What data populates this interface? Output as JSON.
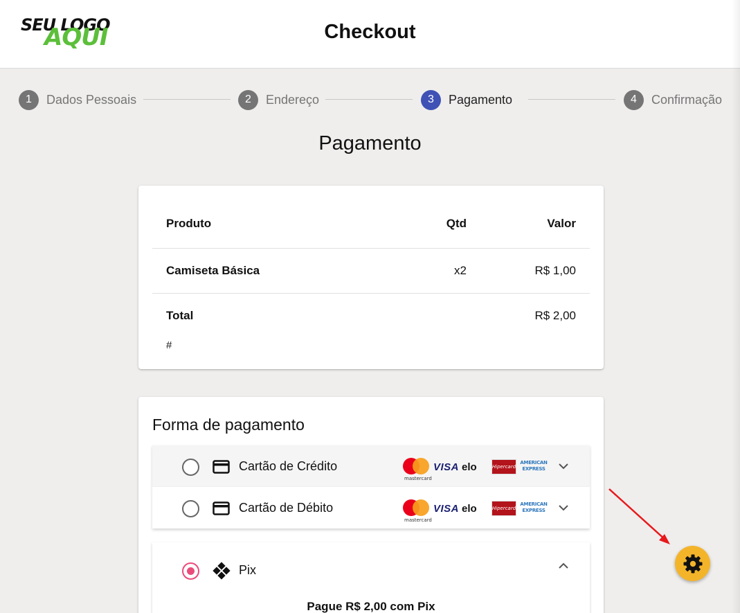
{
  "header": {
    "logo_line1": "SEU LOGO",
    "logo_line2": "AQUI",
    "title": "Checkout"
  },
  "stepper": {
    "steps": [
      {
        "number": "1",
        "label": "Dados Pessoais",
        "state": "completed"
      },
      {
        "number": "2",
        "label": "Endereço",
        "state": "completed"
      },
      {
        "number": "3",
        "label": "Pagamento",
        "state": "active"
      },
      {
        "number": "4",
        "label": "Confirmação",
        "state": "pending"
      }
    ]
  },
  "page_title": "Pagamento",
  "summary": {
    "headers": {
      "product": "Produto",
      "qty": "Qtd",
      "value": "Valor"
    },
    "items": [
      {
        "product": "Camiseta Básica",
        "qty": "x2",
        "value": "R$ 1,00"
      }
    ],
    "total_label": "Total",
    "total_value": "R$ 2,00",
    "hash": "#"
  },
  "payment": {
    "title": "Forma de pagamento",
    "options": [
      {
        "label": "Cartão de Crédito",
        "icon": "credit-card-icon",
        "selected": false,
        "expanded": false
      },
      {
        "label": "Cartão de Débito",
        "icon": "credit-card-icon",
        "selected": false,
        "expanded": false
      },
      {
        "label": "Pix",
        "icon": "pix-icon",
        "selected": true,
        "expanded": true
      }
    ],
    "brands": {
      "mastercard": "mastercard",
      "visa": "VISA",
      "elo": "elo",
      "hipercard": "Hipercard",
      "amex_line1": "AMERICAN",
      "amex_line2": "EXPRESS"
    },
    "pix_note": "Pague R$ 2,00 com Pix"
  },
  "colors": {
    "active_step": "#3f51b5",
    "step_inactive": "#757575",
    "radio_selected": "#ea4c7a",
    "settings_button": "#f4b42a",
    "arrow": "#e8191c",
    "logo_green": "#5cbf3a"
  },
  "settings_button": {
    "icon": "gear-icon"
  }
}
